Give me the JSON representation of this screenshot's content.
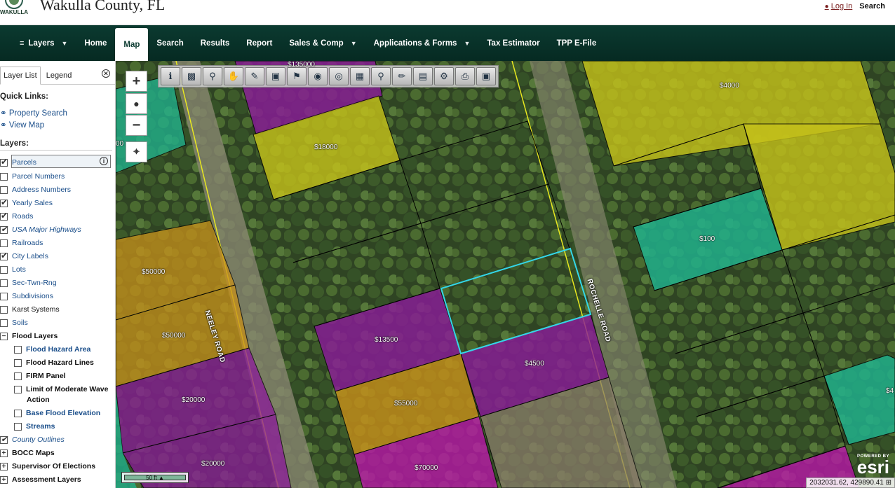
{
  "header": {
    "logo_text": "WAKULLA",
    "title": "Wakulla County, FL",
    "login": "Log In",
    "search": "Search"
  },
  "nav": {
    "items": [
      {
        "label": "Layers"
      },
      {
        "label": "Home"
      },
      {
        "label": "Map"
      },
      {
        "label": "Search"
      },
      {
        "label": "Results"
      },
      {
        "label": "Report"
      },
      {
        "label": "Sales & Comp"
      },
      {
        "label": "Applications & Forms"
      },
      {
        "label": "Tax Estimator"
      },
      {
        "label": "TPP E-File"
      }
    ]
  },
  "sidebar": {
    "tabs": [
      "Layer List",
      "Legend"
    ],
    "quick_links_label": "Quick Links:",
    "quick_links": [
      "Property Search",
      "View Map"
    ],
    "layers_label": "Layers:",
    "layers": [
      {
        "label": "Parcels",
        "checked": true
      },
      {
        "label": "Parcel Numbers",
        "checked": false
      },
      {
        "label": "Address Numbers",
        "checked": false
      },
      {
        "label": "Yearly Sales",
        "checked": true
      },
      {
        "label": "Roads",
        "checked": true
      },
      {
        "label": "USA Major Highways",
        "checked": true
      },
      {
        "label": "Railroads",
        "checked": false
      },
      {
        "label": "City Labels",
        "checked": true
      },
      {
        "label": "Lots",
        "checked": false
      },
      {
        "label": "Sec-Twn-Rng",
        "checked": false
      },
      {
        "label": "Subdivisions",
        "checked": false
      },
      {
        "label": "Karst Systems",
        "checked": false
      },
      {
        "label": "Soils",
        "checked": false
      },
      {
        "label": "Flood Layers",
        "checked": false
      },
      {
        "label": "Flood Hazard Area",
        "checked": false
      },
      {
        "label": "Flood Hazard Lines",
        "checked": false
      },
      {
        "label": "FIRM Panel",
        "checked": false
      },
      {
        "label": "Limit of Moderate Wave",
        "checked": false
      },
      {
        "label": "Action",
        "checked": false
      },
      {
        "label": "Base Flood Elevation",
        "checked": false
      },
      {
        "label": "Streams",
        "checked": false
      },
      {
        "label": "County Outlines",
        "checked": true
      },
      {
        "label": "BOCC Maps",
        "checked": false
      },
      {
        "label": "Supervisor Of Elections",
        "checked": false
      },
      {
        "label": "Assessment Layers",
        "checked": false
      }
    ]
  },
  "map": {
    "prices": [
      "$135000",
      "$18000",
      "$4000",
      "$100",
      "$50000",
      "$50000",
      "$20000",
      "$20000",
      "$13500",
      "$4500",
      "$55000",
      "$70000",
      "00",
      "$4"
    ],
    "roads": [
      "NEELEY ROAD",
      "ROCHELLE ROAD"
    ],
    "scale": "50 ft",
    "esri_small": "POWERED BY",
    "esri_big": "esri",
    "coords": "2032031.62, 429890.41"
  },
  "colors": {
    "nav_bg": "#0b3a30",
    "link": "#1a4e8a",
    "parcel_yellow": "#c6c21a",
    "parcel_purple": "#8b1a9a",
    "parcel_teal": "#1fb591",
    "parcel_orange": "#c8901a",
    "selected_outline": "#34d7e8"
  }
}
